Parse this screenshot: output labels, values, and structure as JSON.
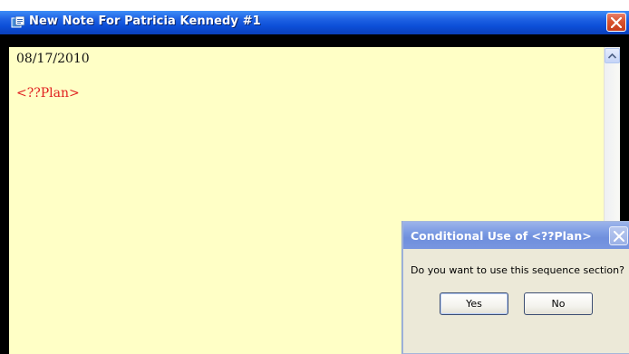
{
  "window": {
    "title": "New Note For Patricia Kennedy #1",
    "icon": "app-note-icon",
    "close_icon": "close-icon"
  },
  "editor": {
    "date": "08/17/2010",
    "plan_tag": "<??Plan>",
    "background": "#ffffc6",
    "tag_color": "#e02020"
  },
  "dialog": {
    "title": "Conditional Use of <??Plan>",
    "message": "Do you want to use this sequence section?",
    "yes_label": "Yes",
    "no_label": "No"
  }
}
